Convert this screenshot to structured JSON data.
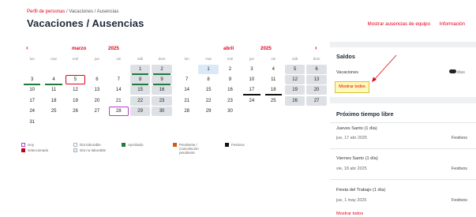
{
  "header": {
    "breadcrumb_link": "Perfil de personas",
    "breadcrumb_sep": " / ",
    "breadcrumb_current": "Vacaciones / Ausencias",
    "title": "Vacaciones / Ausencias",
    "link_team": "Mostrar ausencias de equipo",
    "link_info": "Información"
  },
  "calendar": {
    "prev_icon": "chevron-left-icon",
    "next_icon": "chevron-right-icon",
    "prev_glyph": "‹",
    "next_glyph": "›",
    "weekdays": [
      "lun",
      "mar",
      "mié",
      "jue",
      "vie",
      "sáb",
      "dom"
    ],
    "months": [
      {
        "name": "marzo",
        "year": "2025",
        "offset": 5,
        "days": 31,
        "weekend_cols": [
          5,
          6
        ],
        "today": [
          5
        ],
        "selected": [
          28
        ],
        "blue": [],
        "approved": [
          1,
          2,
          3,
          4,
          8,
          9
        ],
        "pending": [],
        "holiday": []
      },
      {
        "name": "abril",
        "year": "2025",
        "offset": 1,
        "days": 30,
        "weekend_cols": [
          5,
          6
        ],
        "today": [],
        "selected": [],
        "blue": [
          1
        ],
        "approved": [],
        "pending": [],
        "holiday": [
          17,
          18
        ]
      }
    ]
  },
  "legend": {
    "today": "Hoy",
    "selected": "seleccionado",
    "workday": "Día laborable",
    "nonworkday": "Día no laborable",
    "approved": "Aprobado",
    "pending_l1": "Pendiente /",
    "pending_l2": "Cancelación",
    "pending_l3": "pendiente",
    "holidays": "Festivos"
  },
  "saldos": {
    "title": "Saldos",
    "row_label": "Vacaciones",
    "row_value_suffix": "días",
    "button": "Mostrar todos"
  },
  "proximo": {
    "title": "Próximo tiempo libre",
    "events": [
      {
        "name": "Jueves Santo (1 día)",
        "date": "jue, 17 abr 2025",
        "type": "Festivos"
      },
      {
        "name": "Viernes Santo (1 día)",
        "date": "vie, 18 abr 2025",
        "type": "Festivos"
      },
      {
        "name": "Fiesta del Trabajo (1 día)",
        "date": "jue, 1 may 2025",
        "type": "Festivos"
      }
    ],
    "more": "Mostrar todos"
  },
  "colors": {
    "accent": "#e4001b",
    "approved": "#1f7a3b",
    "pending": "#d45a12",
    "holiday": "#111111",
    "selected_border": "#b33fc7",
    "weekend_bg": "#dde1e6",
    "annotation_highlight": "#fff9b8",
    "annotation_arrow": "#e4001b"
  }
}
